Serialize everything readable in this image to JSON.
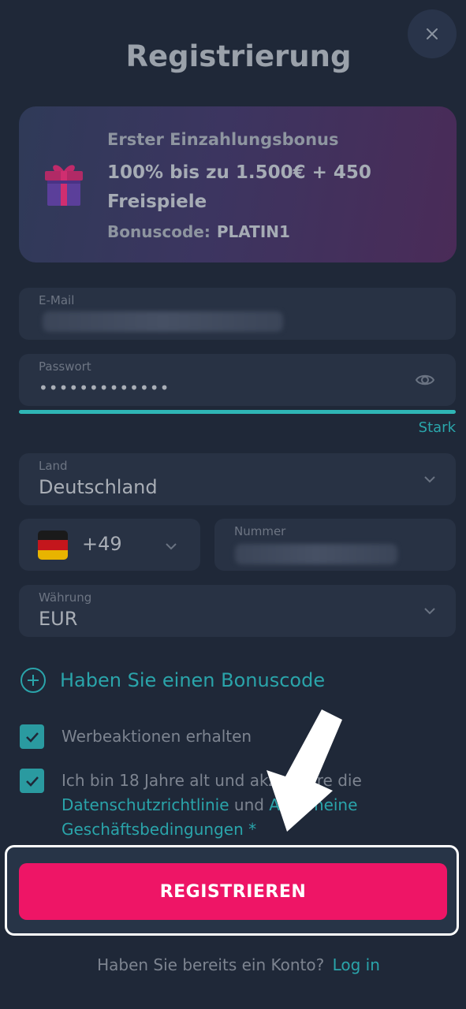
{
  "dialog": {
    "title": "Registrierung",
    "close_icon": "close-icon"
  },
  "bonus": {
    "heading": "Erster Einzahlungsbonus",
    "offer": "100% bis zu 1.500€ + 450 Freispiele",
    "code_label": "Bonuscode:",
    "code_value": "PLATIN1",
    "icon": "gift-icon"
  },
  "form": {
    "email": {
      "label": "E-Mail",
      "value_hidden": true
    },
    "password": {
      "label": "Passwort",
      "value": "•••••••••••••",
      "strength": "Stark",
      "strength_level": 1.0
    },
    "country": {
      "label": "Land",
      "value": "Deutschland"
    },
    "phone": {
      "prefix": "+49",
      "flag": "germany-flag",
      "label": "Nummer",
      "value_hidden": true
    },
    "currency": {
      "label": "Währung",
      "value": "EUR"
    }
  },
  "bonus_code_link": "Haben Sie einen Bonuscode",
  "checkboxes": {
    "promo": {
      "label": "Werbeaktionen erhalten",
      "checked": true
    },
    "terms": {
      "prefix": "Ich bin 18 Jahre alt und akzeptiere die",
      "privacy_link": "Datenschutzrichtlinie",
      "and": "und",
      "terms_link": "Allgemeine Geschäftsbedingungen",
      "asterisk": "*",
      "checked": true
    }
  },
  "register_button": "REGISTRIEREN",
  "footer": {
    "question": "Haben Sie bereits ein Konto?",
    "login_link": "Log in"
  },
  "colors": {
    "background": "#1f2838",
    "accent": "#2aa4aa",
    "primary_button": "#ee1566"
  }
}
